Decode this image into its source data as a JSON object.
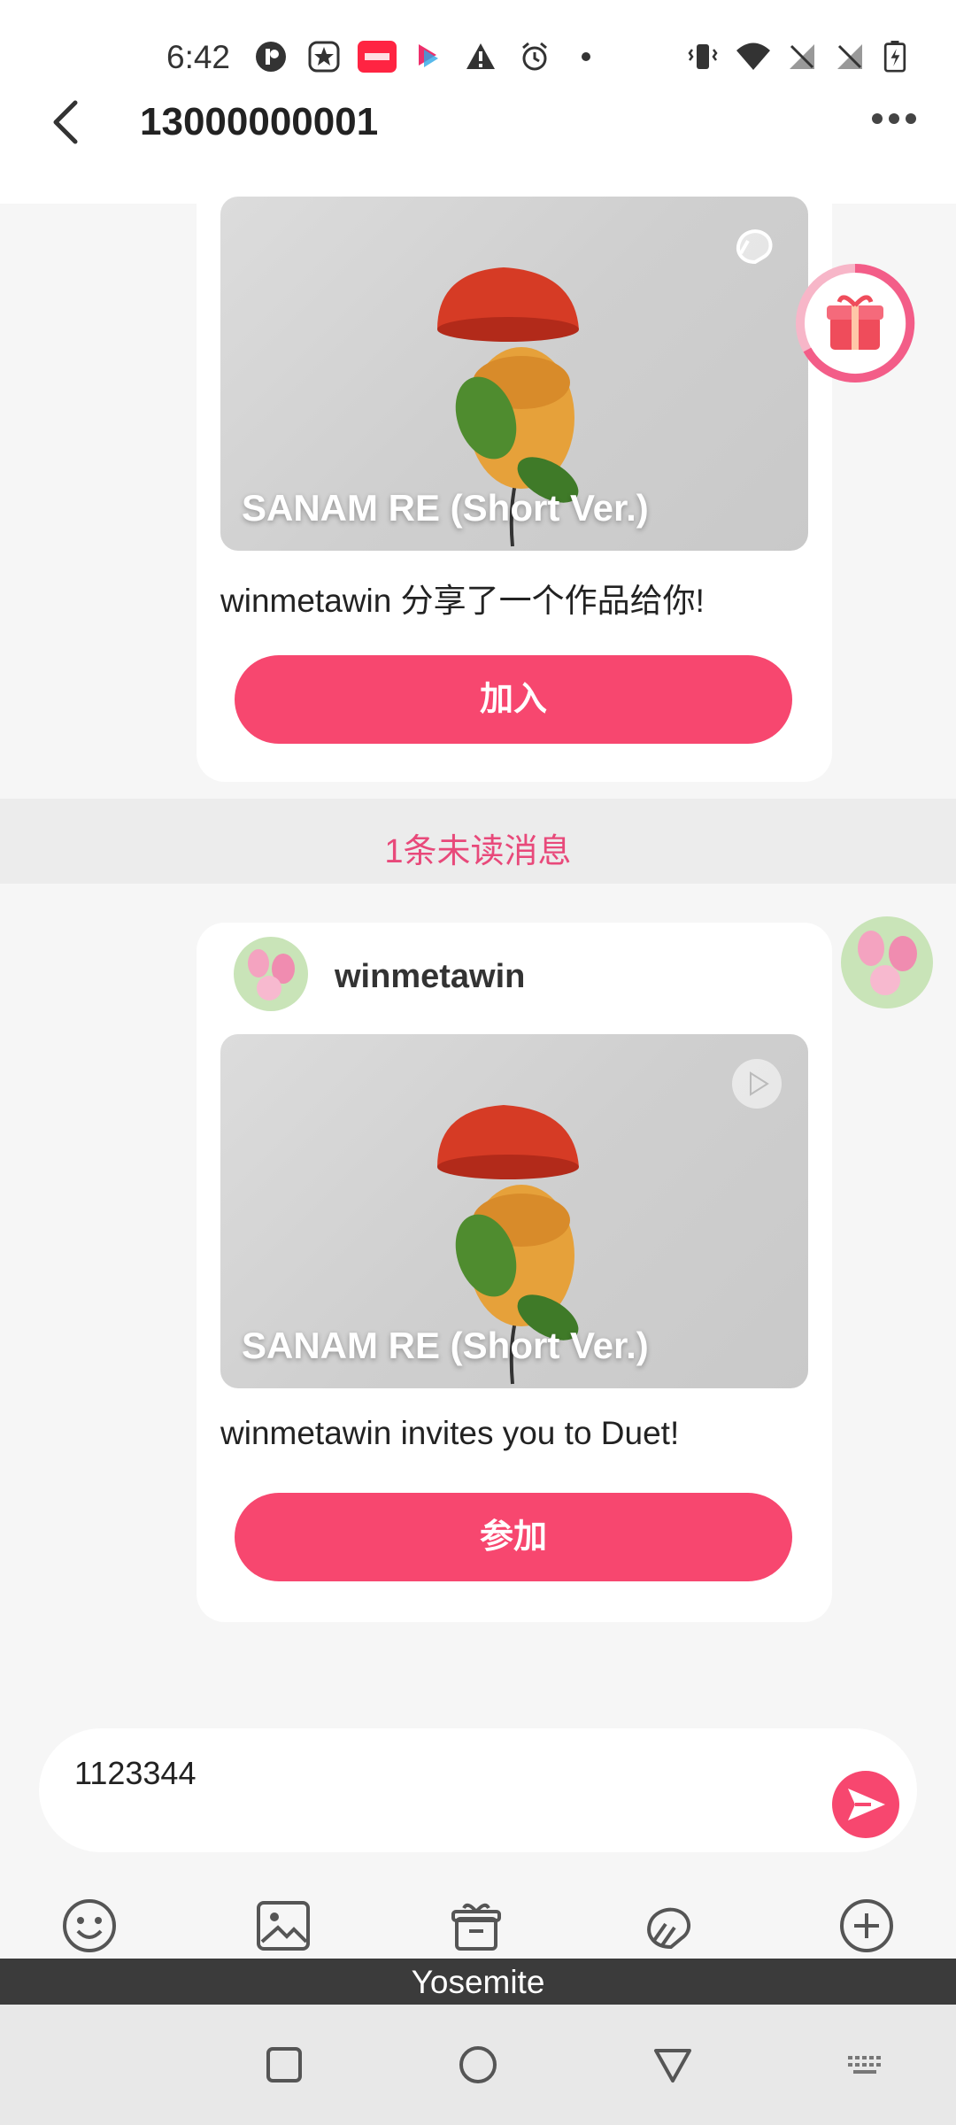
{
  "status_bar": {
    "time": "6:42",
    "left_icons": [
      "app-icon",
      "star-app-icon",
      "xiaohongshu-icon",
      "video-app-icon",
      "warning-icon",
      "alarm-icon",
      "dot-icon"
    ],
    "right_icons": [
      "vibrate-icon",
      "wifi-icon",
      "signal-off-icon",
      "signal-off-icon",
      "battery-icon"
    ]
  },
  "header": {
    "title": "13000000001"
  },
  "messages": [
    {
      "video_title": "SANAM RE (Short Ver.)",
      "text": "winmetawin 分享了一个作品给你!",
      "button": "加入",
      "corner_icon": "duet-icon"
    },
    {
      "sender": "winmetawin",
      "video_title": "SANAM RE (Short Ver.)",
      "text": "winmetawin invites you to Duet!",
      "button": "参加",
      "corner_icon": "play-icon"
    }
  ],
  "unread_divider": "1条未读消息",
  "input": {
    "value": "1123344"
  },
  "toolbar": [
    "emoji-icon",
    "image-icon",
    "gift-box-icon",
    "duet-icon",
    "add-icon"
  ],
  "keyboard": {
    "label": "Yosemite"
  },
  "colors": {
    "accent": "#f7476f",
    "unread_text": "#e8497a"
  }
}
